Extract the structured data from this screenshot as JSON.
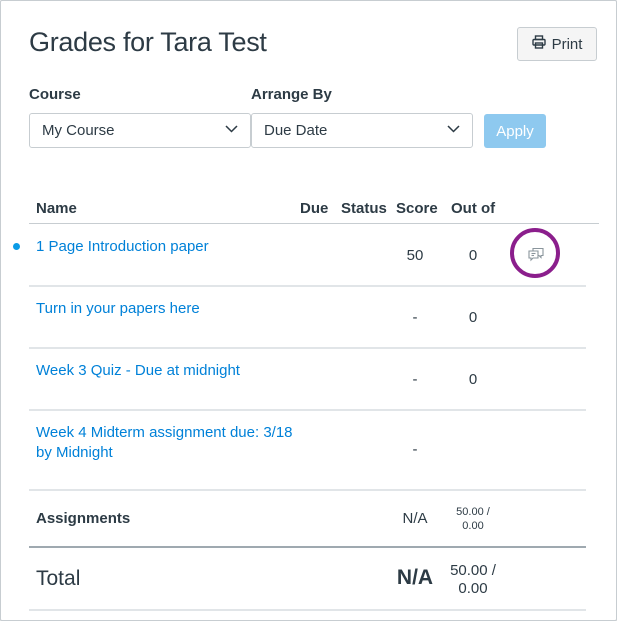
{
  "header": {
    "title": "Grades for Tara Test",
    "print_label": "Print",
    "print_icon": "printer-icon"
  },
  "filters": {
    "course_label": "Course",
    "course_value": "My Course",
    "arrange_label": "Arrange By",
    "arrange_value": "Due Date",
    "apply_label": "Apply",
    "dropdown_icon": "chevron-down-icon"
  },
  "table": {
    "columns": [
      "Name",
      "Due",
      "Status",
      "Score",
      "Out of"
    ],
    "rows": [
      {
        "name": "1 Page Introduction paper",
        "due": "",
        "status": "",
        "score": "50",
        "out_of": "0",
        "unread": true,
        "has_comments": true
      },
      {
        "name": "Turn in your papers here",
        "due": "",
        "status": "",
        "score": "-",
        "out_of": "0",
        "unread": false,
        "has_comments": false
      },
      {
        "name": "Week 3 Quiz - Due at midnight",
        "due": "",
        "status": "",
        "score": "-",
        "out_of": "0",
        "unread": false,
        "has_comments": false
      },
      {
        "name_line1": "Week 4 Midterm assignment due: 3/18",
        "name_line2": "by Midnight",
        "due": "",
        "status": "",
        "score": "-",
        "out_of": "",
        "unread": false,
        "has_comments": false
      }
    ],
    "comment_icon": "comment-bubbles-icon"
  },
  "summary": {
    "group_name": "Assignments",
    "group_score": "N/A",
    "group_points_line1": "50.00 /",
    "group_points_line2": "0.00",
    "total_label": "Total",
    "total_score": "N/A",
    "total_points_line1": "50.00 /",
    "total_points_line2": "0.00"
  },
  "colors": {
    "link": "#0081d8",
    "apply_disabled": "#8ec9ef",
    "highlight_ring": "#8b1e8c",
    "text": "#2d3b45"
  }
}
